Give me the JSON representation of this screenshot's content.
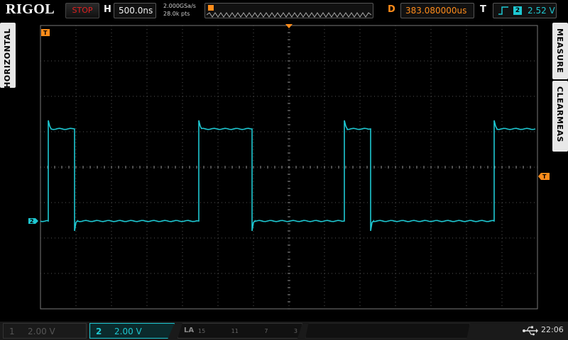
{
  "top": {
    "brand": "RIGOL",
    "run_state": "STOP",
    "h_label": "H",
    "timebase": "500.0ns",
    "sample_rate": "2.000GSa/s",
    "memory_depth": "28.0k pts",
    "d_label": "D",
    "delay": "383.080000us",
    "t_label": "T",
    "trigger_channel": "2",
    "trigger_level": "2.52 V"
  },
  "side": {
    "horizontal": "HORIZONTAL",
    "measure": "MEASURE",
    "clear_meas": "CLEARMEAS"
  },
  "markers": {
    "trigger_left": "T",
    "trigger_right": "T",
    "channel_ref": "2"
  },
  "bottom": {
    "ch1_num": "1",
    "ch1_scale": "2.00 V",
    "ch2_num": "2",
    "ch2_scale": "2.00 V",
    "la_label": "LA",
    "la_digits": [
      "15",
      "11",
      "7",
      "3"
    ],
    "time": "22:06"
  },
  "colors": {
    "ch2": "#1ec8d2",
    "accent": "#ff8c1a",
    "stop": "#e02020",
    "grid": "#555555"
  },
  "icons": [
    "usb-icon",
    "rising-edge-icon"
  ]
}
